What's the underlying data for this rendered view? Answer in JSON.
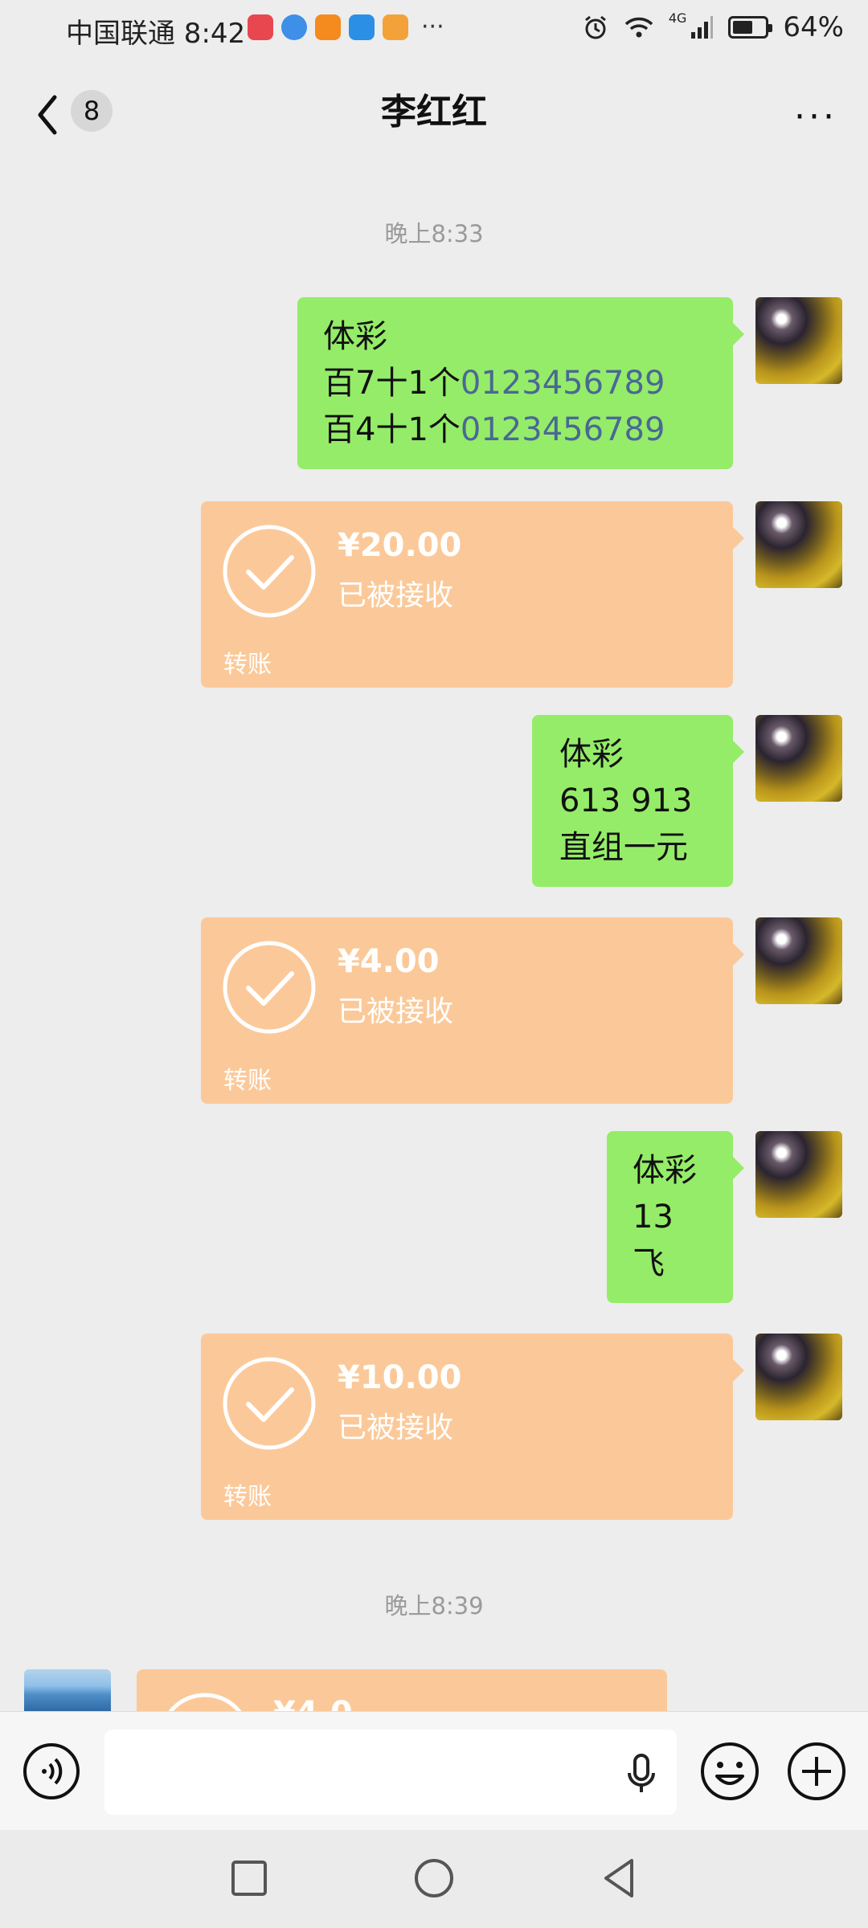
{
  "status_bar": {
    "carrier_time": "中国联通 8:42",
    "app_icons": [
      "huawei-app-icon",
      "browser-app-icon",
      "video-app-icon",
      "weather-app-icon",
      "game-app-icon"
    ],
    "overflow": "···",
    "network": "4G",
    "battery_percent": "64%",
    "battery_level": 0.64
  },
  "header": {
    "back_icon": "chevron-left-icon",
    "unread_count": "8",
    "title": "李红红",
    "more_label": "···"
  },
  "messages": [
    {
      "type": "time",
      "text": "晚上8:33"
    },
    {
      "type": "text",
      "side": "right",
      "lines": [
        "体彩",
        "百7十1个",
        "百4十1个"
      ],
      "digits": [
        "0123456789",
        "0123456789"
      ]
    },
    {
      "type": "transfer",
      "side": "right",
      "amount": "¥20.00",
      "status": "已被接收",
      "label": "转账"
    },
    {
      "type": "text",
      "side": "right",
      "lines": [
        "体彩",
        "613 913",
        "直组一元"
      ]
    },
    {
      "type": "transfer",
      "side": "right",
      "amount": "¥4.00",
      "status": "已被接收",
      "label": "转账"
    },
    {
      "type": "text",
      "side": "right",
      "lines": [
        "体彩",
        "13",
        "飞"
      ]
    },
    {
      "type": "transfer",
      "side": "right",
      "amount": "¥10.00",
      "status": "已被接收",
      "label": "转账"
    },
    {
      "type": "time",
      "text": "晚上8:39"
    },
    {
      "type": "transfer",
      "side": "left",
      "amount": "¥4.0",
      "status": "",
      "label": ""
    }
  ],
  "input_bar": {
    "voice_icon": "voice-icon",
    "mic_icon": "microphone-icon",
    "emoji_icon": "emoji-icon",
    "plus_icon": "plus-icon"
  },
  "nav_bar": {
    "icons": [
      "recent-apps-icon",
      "home-icon",
      "back-icon"
    ]
  },
  "colors": {
    "my_bubble": "#95ec69",
    "transfer_bubble": "#fbc999",
    "background": "#ededed",
    "digit_link": "#4a6894"
  }
}
